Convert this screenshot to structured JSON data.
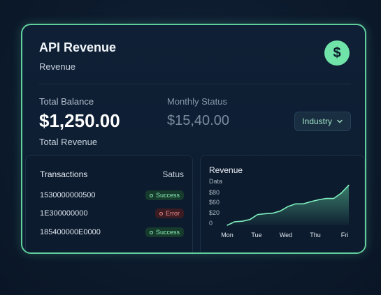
{
  "card": {
    "title": "API Revenue",
    "subtitle": "Revenue",
    "icon": "dollar-icon"
  },
  "balance": {
    "label": "Total Balance",
    "value": "$1,250.00",
    "caption": "Total Revenue"
  },
  "monthly": {
    "label": "Monthly Status",
    "value": "$15,40.00"
  },
  "dropdown": {
    "selected": "Industry",
    "icon": "chevron-down-icon"
  },
  "transactions": {
    "header": "Transactions",
    "status_header": "Satus",
    "rows": [
      {
        "id": "1530000000500",
        "status": "Success",
        "kind": "success"
      },
      {
        "id": "1E300000000",
        "status": "Error",
        "kind": "error"
      },
      {
        "id": "185400000E0000",
        "status": "Success",
        "kind": "success"
      }
    ]
  },
  "colors": {
    "accent": "#5fcf9e",
    "success": "#8af0b8",
    "error": "#f28b8b"
  },
  "chart_data": {
    "type": "area",
    "title": "Revenue",
    "y_tick_labels": [
      "Data",
      "$80",
      "$60",
      "$20",
      "0"
    ],
    "categories": [
      "Mon",
      "Tue",
      "Wed",
      "Thu",
      "Fri"
    ],
    "x": [
      0,
      0.5,
      1,
      1.5,
      2,
      2.5,
      3,
      3.5,
      4,
      4.5,
      5,
      5.5,
      6,
      6.5,
      7,
      7.5,
      8
    ],
    "values": [
      0,
      8,
      9,
      13,
      24,
      26,
      27,
      32,
      42,
      48,
      48,
      53,
      57,
      60,
      60,
      72,
      90
    ],
    "ylim": [
      0,
      100
    ],
    "xlim": [
      0,
      8
    ]
  }
}
